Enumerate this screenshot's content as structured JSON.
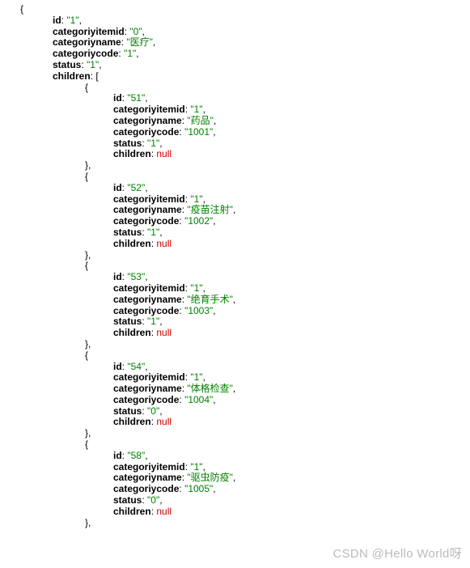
{
  "root": {
    "open_brace": "{",
    "props": [
      {
        "key": "id",
        "colon": ":",
        "val": "\"1\"",
        "comma": ",",
        "cls": "str"
      },
      {
        "key": "categoriyitemid",
        "colon": ":",
        "val": "\"0\"",
        "comma": ",",
        "cls": "str"
      },
      {
        "key": "categoriyname",
        "colon": ":",
        "val": "\"医疗\"",
        "comma": ",",
        "cls": "str"
      },
      {
        "key": "categoriycode",
        "colon": ":",
        "val": "\"1\"",
        "comma": ",",
        "cls": "str"
      },
      {
        "key": "status",
        "colon": ":",
        "val": "\"1\"",
        "comma": ",",
        "cls": "str"
      },
      {
        "key": "children",
        "colon": ":",
        "val": "[",
        "comma": "",
        "cls": "punc"
      }
    ]
  },
  "children_entries": [
    {
      "open_brace": "{",
      "props": [
        {
          "key": "id",
          "val": "\"51\"",
          "cls": "str"
        },
        {
          "key": "categoriyitemid",
          "val": "\"1\"",
          "cls": "str"
        },
        {
          "key": "categoriyname",
          "val": "\"药品\"",
          "cls": "str"
        },
        {
          "key": "categoriycode",
          "val": "\"1001\"",
          "cls": "str"
        },
        {
          "key": "status",
          "val": "\"1\"",
          "cls": "str"
        },
        {
          "key": "children",
          "val": "null",
          "cls": "null",
          "last": true
        }
      ],
      "close_brace": "},"
    },
    {
      "open_brace": "{",
      "props": [
        {
          "key": "id",
          "val": "\"52\"",
          "cls": "str"
        },
        {
          "key": "categoriyitemid",
          "val": "\"1\"",
          "cls": "str"
        },
        {
          "key": "categoriyname",
          "val": "\"疫苗注射\"",
          "cls": "str"
        },
        {
          "key": "categoriycode",
          "val": "\"1002\"",
          "cls": "str"
        },
        {
          "key": "status",
          "val": "\"1\"",
          "cls": "str"
        },
        {
          "key": "children",
          "val": "null",
          "cls": "null",
          "last": true
        }
      ],
      "close_brace": "},"
    },
    {
      "open_brace": "{",
      "props": [
        {
          "key": "id",
          "val": "\"53\"",
          "cls": "str"
        },
        {
          "key": "categoriyitemid",
          "val": "\"1\"",
          "cls": "str"
        },
        {
          "key": "categoriyname",
          "val": "\"绝育手术\"",
          "cls": "str"
        },
        {
          "key": "categoriycode",
          "val": "\"1003\"",
          "cls": "str"
        },
        {
          "key": "status",
          "val": "\"1\"",
          "cls": "str"
        },
        {
          "key": "children",
          "val": "null",
          "cls": "null",
          "last": true
        }
      ],
      "close_brace": "},"
    },
    {
      "open_brace": "{",
      "props": [
        {
          "key": "id",
          "val": "\"54\"",
          "cls": "str"
        },
        {
          "key": "categoriyitemid",
          "val": "\"1\"",
          "cls": "str"
        },
        {
          "key": "categoriyname",
          "val": "\"体格检查\"",
          "cls": "str"
        },
        {
          "key": "categoriycode",
          "val": "\"1004\"",
          "cls": "str"
        },
        {
          "key": "status",
          "val": "\"0\"",
          "cls": "str"
        },
        {
          "key": "children",
          "val": "null",
          "cls": "null",
          "last": true
        }
      ],
      "close_brace": "},"
    },
    {
      "open_brace": "{",
      "props": [
        {
          "key": "id",
          "val": "\"58\"",
          "cls": "str"
        },
        {
          "key": "categoriyitemid",
          "val": "\"1\"",
          "cls": "str"
        },
        {
          "key": "categoriyname",
          "val": "\"驱虫防疫\"",
          "cls": "str"
        },
        {
          "key": "categoriycode",
          "val": "\"1005\"",
          "cls": "str"
        },
        {
          "key": "status",
          "val": "\"0\"",
          "cls": "str"
        },
        {
          "key": "children",
          "val": "null",
          "cls": "null",
          "last": true
        }
      ],
      "close_brace": "},"
    }
  ],
  "watermark": "CSDN @Hello World呀"
}
